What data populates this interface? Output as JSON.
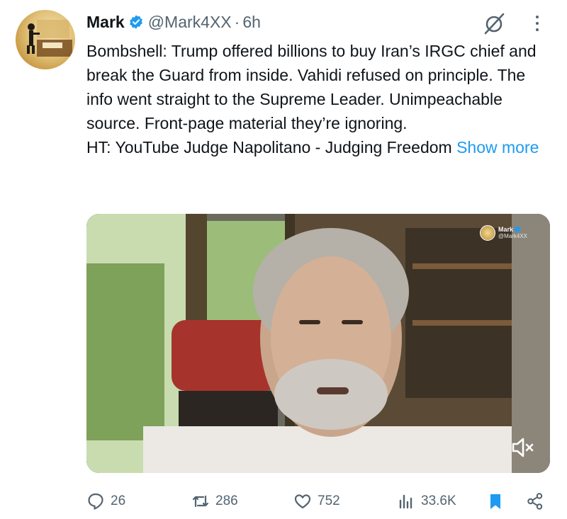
{
  "author": {
    "display_name": "Mark",
    "handle": "@Mark4XX",
    "separator": "·",
    "time": "6h",
    "verified": true,
    "avatar_icon": "avatar-image"
  },
  "header_icons": {
    "grok": "grok-icon",
    "more": "more-options-icon"
  },
  "tweet": {
    "paragraph_1": "Bombshell: Trump offered billions to buy Iran’s IRGC chief and break the Guard from inside. Vahidi refused on principle. The info went straight to the Supreme Leader. Unimpeachable source. Front-page material they’re ignoring.",
    "paragraph_2": "HT: YouTube Judge Napolitano - Judging Freedom",
    "show_more": "Show more"
  },
  "media": {
    "type": "video",
    "watermark": {
      "name": "Mark",
      "handle": "@Mark4XX"
    },
    "mute_icon": "volume-muted-icon"
  },
  "actions": {
    "reply_count": "26",
    "retweet_count": "286",
    "like_count": "752",
    "views_count": "33.6K"
  },
  "colors": {
    "text_primary": "#0f1419",
    "text_secondary": "#536471",
    "accent": "#1d9bf0"
  }
}
